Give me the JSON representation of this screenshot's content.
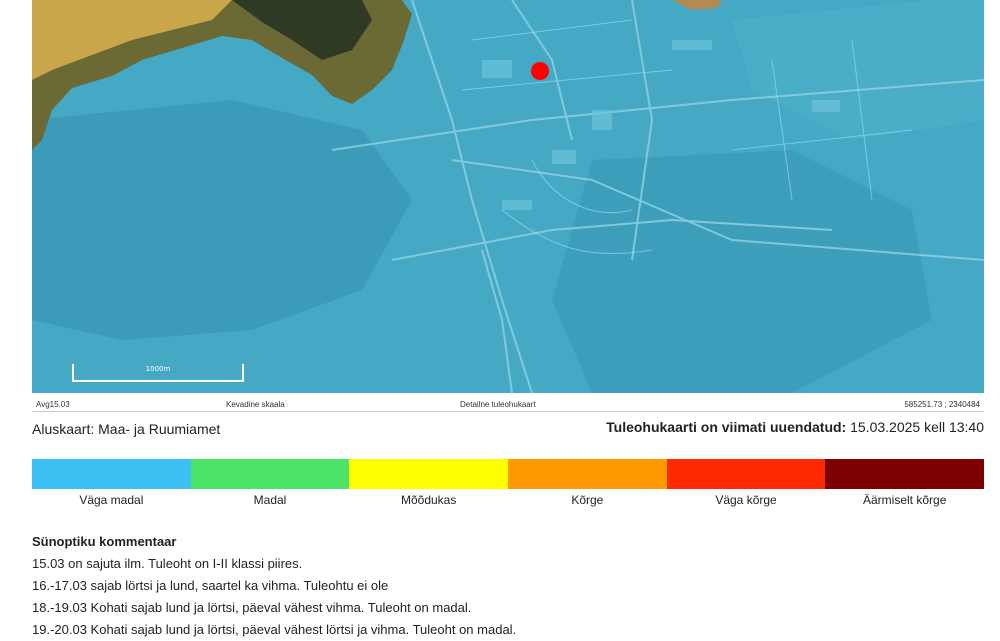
{
  "map": {
    "scale_label": "1000m",
    "status": {
      "left": "Avg15.03",
      "center_left": "Kevadine skaala",
      "center": "Detailne tuleohukaart",
      "coords": "585251.73 ; 2340484"
    }
  },
  "credit": "Aluskaart: Maa- ja Ruumiamet",
  "updated": {
    "label": "Tuleohukaarti on viimati uuendatud:",
    "value": "15.03.2025 kell 13:40"
  },
  "legend": [
    {
      "label": "Väga madal",
      "color": "#3cc0f2"
    },
    {
      "label": "Madal",
      "color": "#4ce56a"
    },
    {
      "label": "Mõõdukas",
      "color": "#ffff00"
    },
    {
      "label": "Kõrge",
      "color": "#ff9a00"
    },
    {
      "label": "Väga kõrge",
      "color": "#ff2a00"
    },
    {
      "label": "Äärmiselt kõrge",
      "color": "#7d0000"
    }
  ],
  "comment": {
    "title": "Sünoptiku kommentaar",
    "lines": [
      "15.03 on sajuta ilm. Tuleoht on I-II klassi piires.",
      "16.-17.03 sajab lörtsi ja lund, saartel ka vihma. Tuleohtu ei ole",
      "18.-19.03 Kohati sajab lund ja lörtsi, päeval vähest vihma. Tuleoht on madal.",
      "19.-20.03 Kohati sajab lund ja lörtsi, päeval vähest lörtsi ja vihma. Tuleoht on madal."
    ]
  }
}
